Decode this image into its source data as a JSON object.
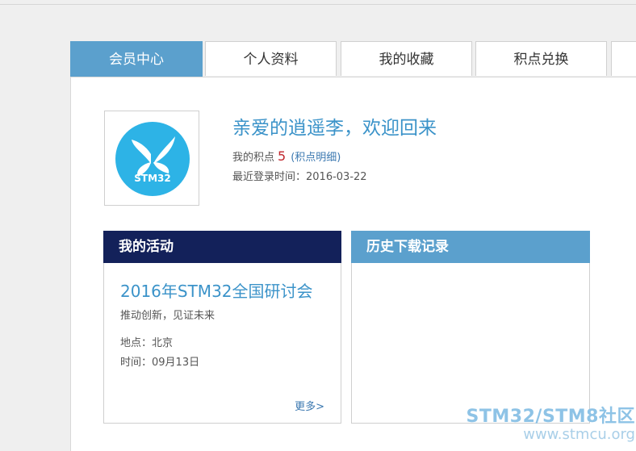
{
  "tabs": [
    {
      "label": "会员中心",
      "active": true
    },
    {
      "label": "个人资料",
      "active": false
    },
    {
      "label": "我的收藏",
      "active": false
    },
    {
      "label": "积点兑换",
      "active": false
    }
  ],
  "profile": {
    "avatar_text": "STM32",
    "welcome": "亲爱的逍遥李，欢迎回来",
    "points_label": "我的积点",
    "points_value": "5",
    "points_detail": "(积点明细)",
    "last_login": "最近登录时间：2016-03-22"
  },
  "activity": {
    "header": "我的活动",
    "title": "2016年STM32全国研讨会",
    "subtitle": "推动创新，见证未来",
    "location": "地点：北京",
    "time": "时间：09月13日",
    "more": "更多>"
  },
  "history": {
    "header": "历史下载记录"
  },
  "watermark": {
    "main": "STM32/STM8社区",
    "sub": "www.stmcu.org"
  },
  "colors": {
    "accent": "#5ba0cd",
    "activity_header": "#13215a",
    "link": "#3b93c9",
    "points": "#c0272d",
    "avatar_circle": "#2db3e6"
  }
}
